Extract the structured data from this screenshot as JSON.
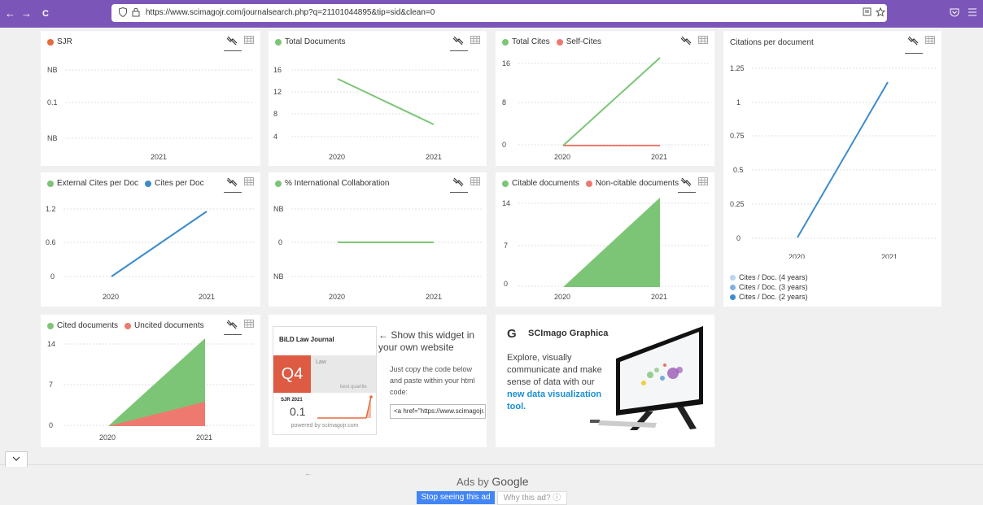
{
  "browser": {
    "back_glyph": "←",
    "forward_glyph": "→",
    "reload_glyph": "C",
    "url": "https://www.scimagojr.com/journalsearch.php?q=21101044895&tip=sid&clean=0",
    "accent": "#7b56b8"
  },
  "colors": {
    "green": "#7cc576",
    "orange": "#e86b3a",
    "red": "#ee7a6f",
    "blue": "#3c8ccd",
    "lightblue": "#b7d4f0",
    "midblue": "#7fb1e0"
  },
  "charts": {
    "sjr": {
      "legend": [
        {
          "label": "SJR",
          "color": "#e86b3a"
        }
      ]
    },
    "total_docs": {
      "legend": [
        {
          "label": "Total Documents",
          "color": "#7cc576"
        }
      ]
    },
    "total_cites": {
      "legend": [
        {
          "label": "Total Cites",
          "color": "#7cc576"
        },
        {
          "label": "Self-Cites",
          "color": "#ee7a6f"
        }
      ]
    },
    "cites_per_doc": {
      "title": "Citations per document",
      "lower_legend": [
        "Cites / Doc. (4 years)",
        "Cites / Doc. (3 years)",
        "Cites / Doc. (2 years)"
      ]
    },
    "ext_cites": {
      "legend": [
        {
          "label": "External Cites per Doc",
          "color": "#7cc576"
        },
        {
          "label": "Cites per Doc",
          "color": "#3c8ccd"
        }
      ]
    },
    "intl": {
      "legend": [
        {
          "label": "% International Collaboration",
          "color": "#7cc576"
        }
      ]
    },
    "citable": {
      "legend": [
        {
          "label": "Citable documents",
          "color": "#7cc576"
        },
        {
          "label": "Non-citable documents",
          "color": "#ee7a6f"
        }
      ]
    },
    "cited": {
      "legend": [
        {
          "label": "Cited documents",
          "color": "#7cc576"
        },
        {
          "label": "Uncited documents",
          "color": "#ee7a6f"
        }
      ]
    }
  },
  "chart_data": [
    {
      "type": "line",
      "id": "sjr",
      "x": [
        "2021"
      ],
      "yticks": [
        "NB",
        "0.1",
        "NB"
      ],
      "series": [
        {
          "name": "SJR",
          "values": [
            0.1
          ]
        }
      ]
    },
    {
      "type": "line",
      "id": "total_docs",
      "x": [
        "2020",
        "2021"
      ],
      "yticks": [
        "16",
        "12",
        "8",
        "4"
      ],
      "ylim": [
        2,
        17
      ],
      "series": [
        {
          "name": "Total Documents",
          "values": [
            14,
            6
          ]
        }
      ]
    },
    {
      "type": "line",
      "id": "total_cites",
      "x": [
        "2020",
        "2021"
      ],
      "yticks": [
        "16",
        "8",
        "0"
      ],
      "ylim": [
        0,
        17
      ],
      "series": [
        {
          "name": "Total Cites",
          "values": [
            0,
            16
          ]
        },
        {
          "name": "Self-Cites",
          "values": [
            0,
            0
          ]
        }
      ]
    },
    {
      "type": "line",
      "id": "cites_per_doc",
      "x": [
        "2020",
        "2021"
      ],
      "yticks": [
        "1.25",
        "1",
        "0.75",
        "0.5",
        "0.25",
        "0"
      ],
      "ylim": [
        0,
        1.3
      ],
      "series": [
        {
          "name": "Cites / Doc. (2 years)",
          "values": [
            0,
            1.14
          ]
        }
      ]
    },
    {
      "type": "line",
      "id": "ext_cites",
      "x": [
        "2020",
        "2021"
      ],
      "yticks": [
        "1.2",
        "0.6",
        "0"
      ],
      "ylim": [
        0,
        1.3
      ],
      "series": [
        {
          "name": "Cites per Doc",
          "values": [
            0,
            1.14
          ]
        }
      ]
    },
    {
      "type": "line",
      "id": "intl",
      "x": [
        "2020",
        "2021"
      ],
      "yticks": [
        "NB",
        "0",
        "NB"
      ],
      "series": [
        {
          "name": "% International Collaboration",
          "values": [
            0,
            0
          ]
        }
      ]
    },
    {
      "type": "area",
      "id": "citable",
      "x": [
        "2020",
        "2021"
      ],
      "yticks": [
        "14",
        "7",
        "0"
      ],
      "ylim": [
        0,
        15
      ],
      "series": [
        {
          "name": "Citable documents",
          "values": [
            0,
            14
          ]
        },
        {
          "name": "Non-citable documents",
          "values": [
            0,
            0
          ]
        }
      ]
    },
    {
      "type": "area",
      "id": "cited",
      "x": [
        "2020",
        "2021"
      ],
      "yticks": [
        "14",
        "7",
        "0"
      ],
      "ylim": [
        0,
        15
      ],
      "series": [
        {
          "name": "Cited documents",
          "values": [
            0,
            14
          ]
        },
        {
          "name": "Uncited documents",
          "values": [
            0,
            4
          ]
        }
      ]
    }
  ],
  "widget": {
    "journal": "BiLD Law Journal",
    "quartile": "Q4",
    "category": "Law",
    "best_quartile": "best quartile",
    "sjr_label": "SJR 2021",
    "sjr_value": "0.1",
    "powered": "powered by scimagojr.com",
    "show_title": "← Show this widget in your own website",
    "instructions": "Just copy the code below and paste within your html code:",
    "code": "<a href=\"https://www.scimagojr.com/journalsearch.php?q=21101044895&tip=sid"
  },
  "graphica": {
    "brand": "SCImago Graphica",
    "text": "Explore, visually communicate and make sense of data with our",
    "link": "new data visualization tool",
    "period": "."
  },
  "ads": {
    "ads_by": "Ads by",
    "google": "Google",
    "stop": "Stop seeing this ad",
    "why": "Why this ad? ⓘ"
  }
}
